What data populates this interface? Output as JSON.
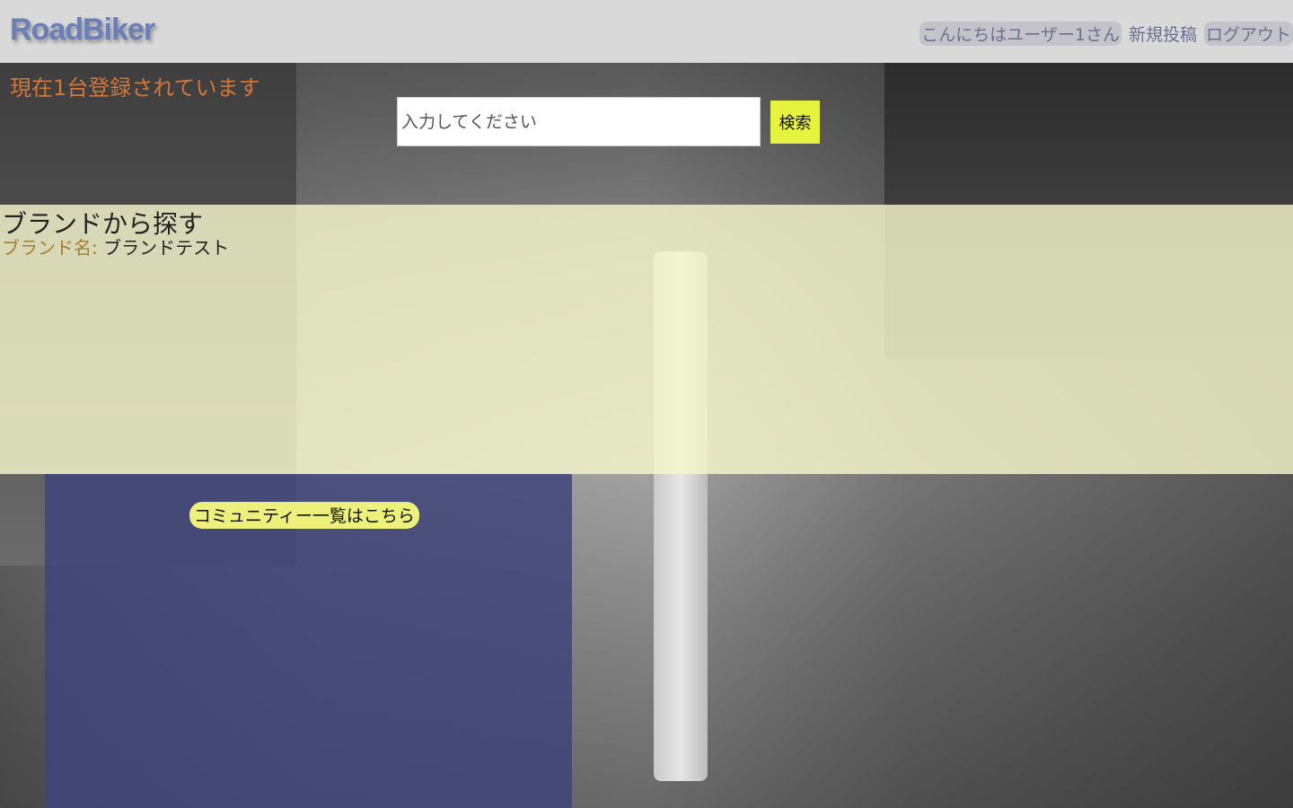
{
  "header": {
    "logo": "RoadBiker",
    "greeting": "こんにちはユーザー1さん",
    "new_post": "新規投稿",
    "logout": "ログアウト"
  },
  "registration_count": "現在1台登録されています",
  "search": {
    "placeholder": "入力してください",
    "button_label": "検索"
  },
  "brand_section": {
    "title": "ブランドから探す",
    "brand_label": "ブランド名:",
    "brand_value": "ブランドテスト"
  },
  "community": {
    "link_label": "コミュニティー一覧はこちら"
  },
  "colors": {
    "header_bg": "#d9d9d9",
    "count_text": "#d2763a",
    "search_button": "#e5f23e",
    "brand_band": "#f5f6cd",
    "community_panel": "#404478",
    "community_link_bg": "#eef07c"
  }
}
